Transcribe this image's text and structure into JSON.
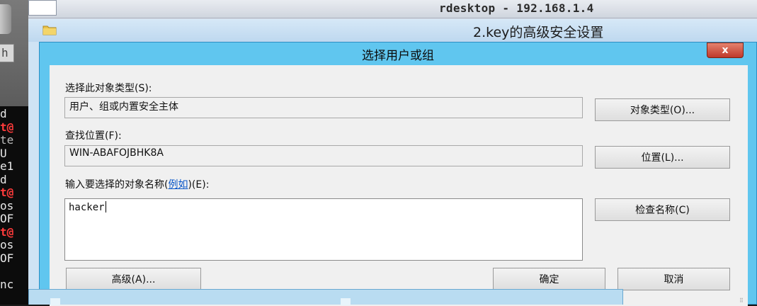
{
  "terminal": {
    "button_label": "h",
    "lines": [
      {
        "text": "d",
        "style": "white"
      },
      {
        "text": "t@",
        "style": "red"
      },
      {
        "text": "te",
        "style": "gray"
      },
      {
        "text": "U",
        "style": "white"
      },
      {
        "text": "e1",
        "style": "white"
      },
      {
        "text": "d",
        "style": "white"
      },
      {
        "text": "t@",
        "style": "red"
      },
      {
        "text": "os",
        "style": "white"
      },
      {
        "text": "OF",
        "style": "white"
      },
      {
        "text": "t@",
        "style": "red"
      },
      {
        "text": "os",
        "style": "white"
      },
      {
        "text": "OF",
        "style": "white"
      },
      {
        "text": "",
        "style": "white"
      },
      {
        "text": "nc",
        "style": "white"
      }
    ]
  },
  "rdesktop": {
    "title": "rdesktop - 192.168.1.4"
  },
  "security_window": {
    "title": "2.key的高级安全设置"
  },
  "dialog": {
    "title": "选择用户或组",
    "close_label": "x",
    "object_type_label": "选择此对象类型(S):",
    "object_type_value": "用户、组或内置安全主体",
    "object_types_button": "对象类型(O)...",
    "location_label": "查找位置(F):",
    "location_value": "WIN-ABAFOJBHK8A",
    "locations_button": "位置(L)...",
    "names_label_prefix": "输入要选择的对象名称(",
    "examples_link": "例如",
    "names_label_suffix": ")(E):",
    "names_value": "hacker",
    "check_names_button": "检查名称(C)",
    "advanced_button": "高级(A)...",
    "ok_button": "确定",
    "cancel_button": "取消"
  }
}
